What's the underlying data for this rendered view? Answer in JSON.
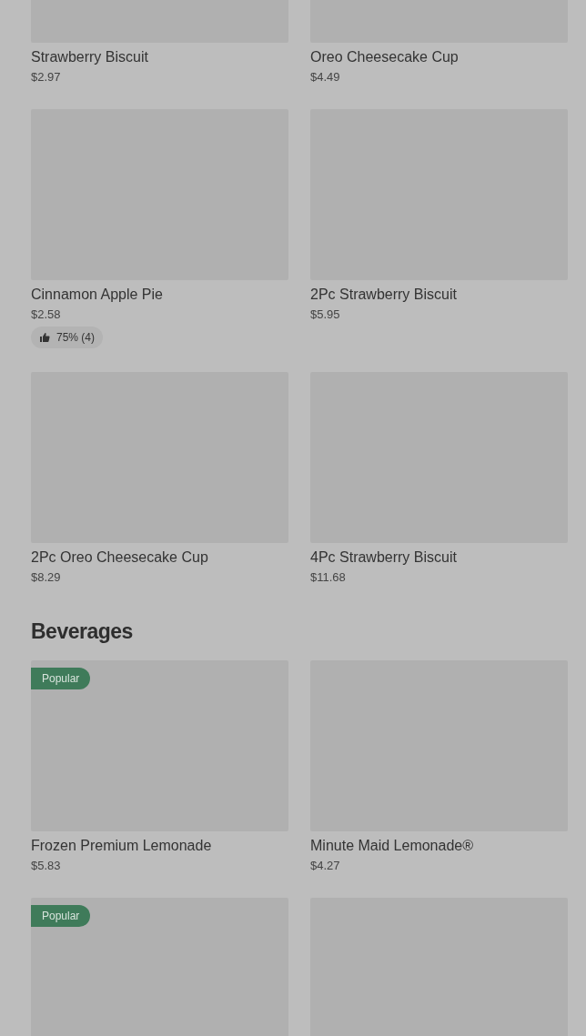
{
  "sections": [
    {
      "items": [
        {
          "kind": "product",
          "name": "Strawberry Biscuit",
          "price": "$2.97"
        },
        {
          "kind": "product",
          "name": "Oreo Cheesecake Cup",
          "price": "$4.49"
        },
        {
          "kind": "product",
          "name": "Cinnamon Apple Pie",
          "price": "$2.58",
          "rating": "75% (4)"
        },
        {
          "kind": "product",
          "name": "2Pc Strawberry Biscuit",
          "price": "$5.95"
        },
        {
          "kind": "product",
          "name": "2Pc Oreo Cheesecake Cup",
          "price": "$8.29"
        },
        {
          "kind": "product",
          "name": "4Pc Strawberry Biscuit",
          "price": "$11.68"
        }
      ]
    },
    {
      "title": "Beverages",
      "items": [
        {
          "kind": "product",
          "badge": "Popular",
          "name": "Frozen Premium Lemonade",
          "price": "$5.83"
        },
        {
          "kind": "product",
          "name": "Minute Maid Lemonade®",
          "price": "$4.27"
        },
        {
          "kind": "product",
          "badge": "Popular"
        },
        {
          "kind": "product"
        }
      ]
    }
  ]
}
